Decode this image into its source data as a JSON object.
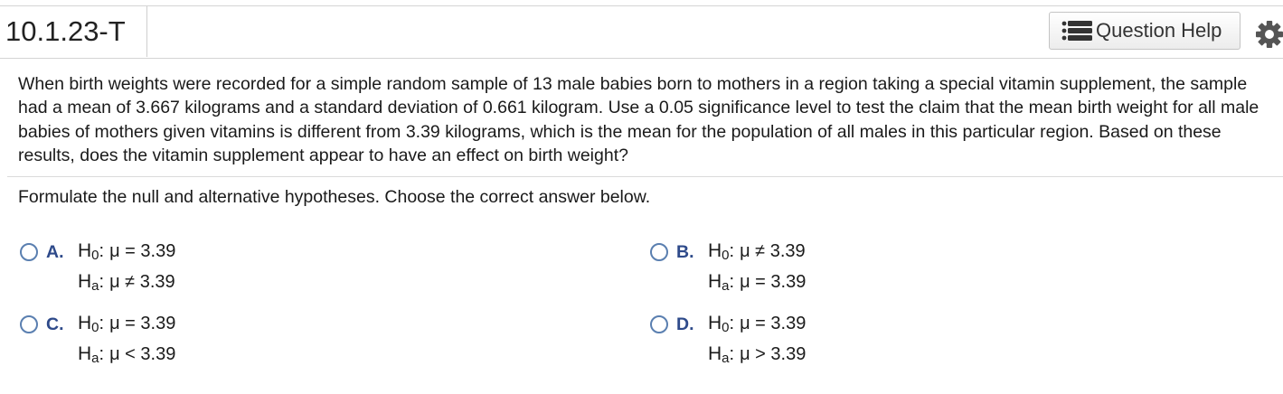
{
  "header": {
    "question_id": "10.1.23-T",
    "help_label": "Question Help"
  },
  "problem_text": "When birth weights were recorded for a simple random sample of 13 male babies born to mothers in a region taking a special vitamin supplement, the sample had a mean of 3.667 kilograms and a standard deviation of 0.661 kilogram. Use a 0.05 significance level to test the claim that the mean birth weight for all male babies of mothers given vitamins is different from 3.39 kilograms, which is the mean for the population of all males in this particular region. Based on these results, does the vitamin supplement appear to have an effect on birth weight?",
  "instruction": "Formulate the null and alternative hypotheses. Choose the correct answer below.",
  "choices": [
    {
      "letter": "A.",
      "h0_sym": "H",
      "h0_sub": "0",
      "h0_rel": "μ = 3.39",
      "ha_sym": "H",
      "ha_sub": "a",
      "ha_rel": "μ ≠ 3.39"
    },
    {
      "letter": "B.",
      "h0_sym": "H",
      "h0_sub": "0",
      "h0_rel": "μ ≠ 3.39",
      "ha_sym": "H",
      "ha_sub": "a",
      "ha_rel": "μ = 3.39"
    },
    {
      "letter": "C.",
      "h0_sym": "H",
      "h0_sub": "0",
      "h0_rel": "μ = 3.39",
      "ha_sym": "H",
      "ha_sub": "a",
      "ha_rel": "μ < 3.39"
    },
    {
      "letter": "D.",
      "h0_sym": "H",
      "h0_sub": "0",
      "h0_rel": "μ = 3.39",
      "ha_sym": "H",
      "ha_sub": "a",
      "ha_rel": "μ > 3.39"
    }
  ],
  "icons": {
    "help": "list-icon",
    "settings": "gear-icon",
    "choice": "radio-icon"
  },
  "colors": {
    "letter": "#2e4a8a",
    "radio_border": "#5a7fb0"
  }
}
